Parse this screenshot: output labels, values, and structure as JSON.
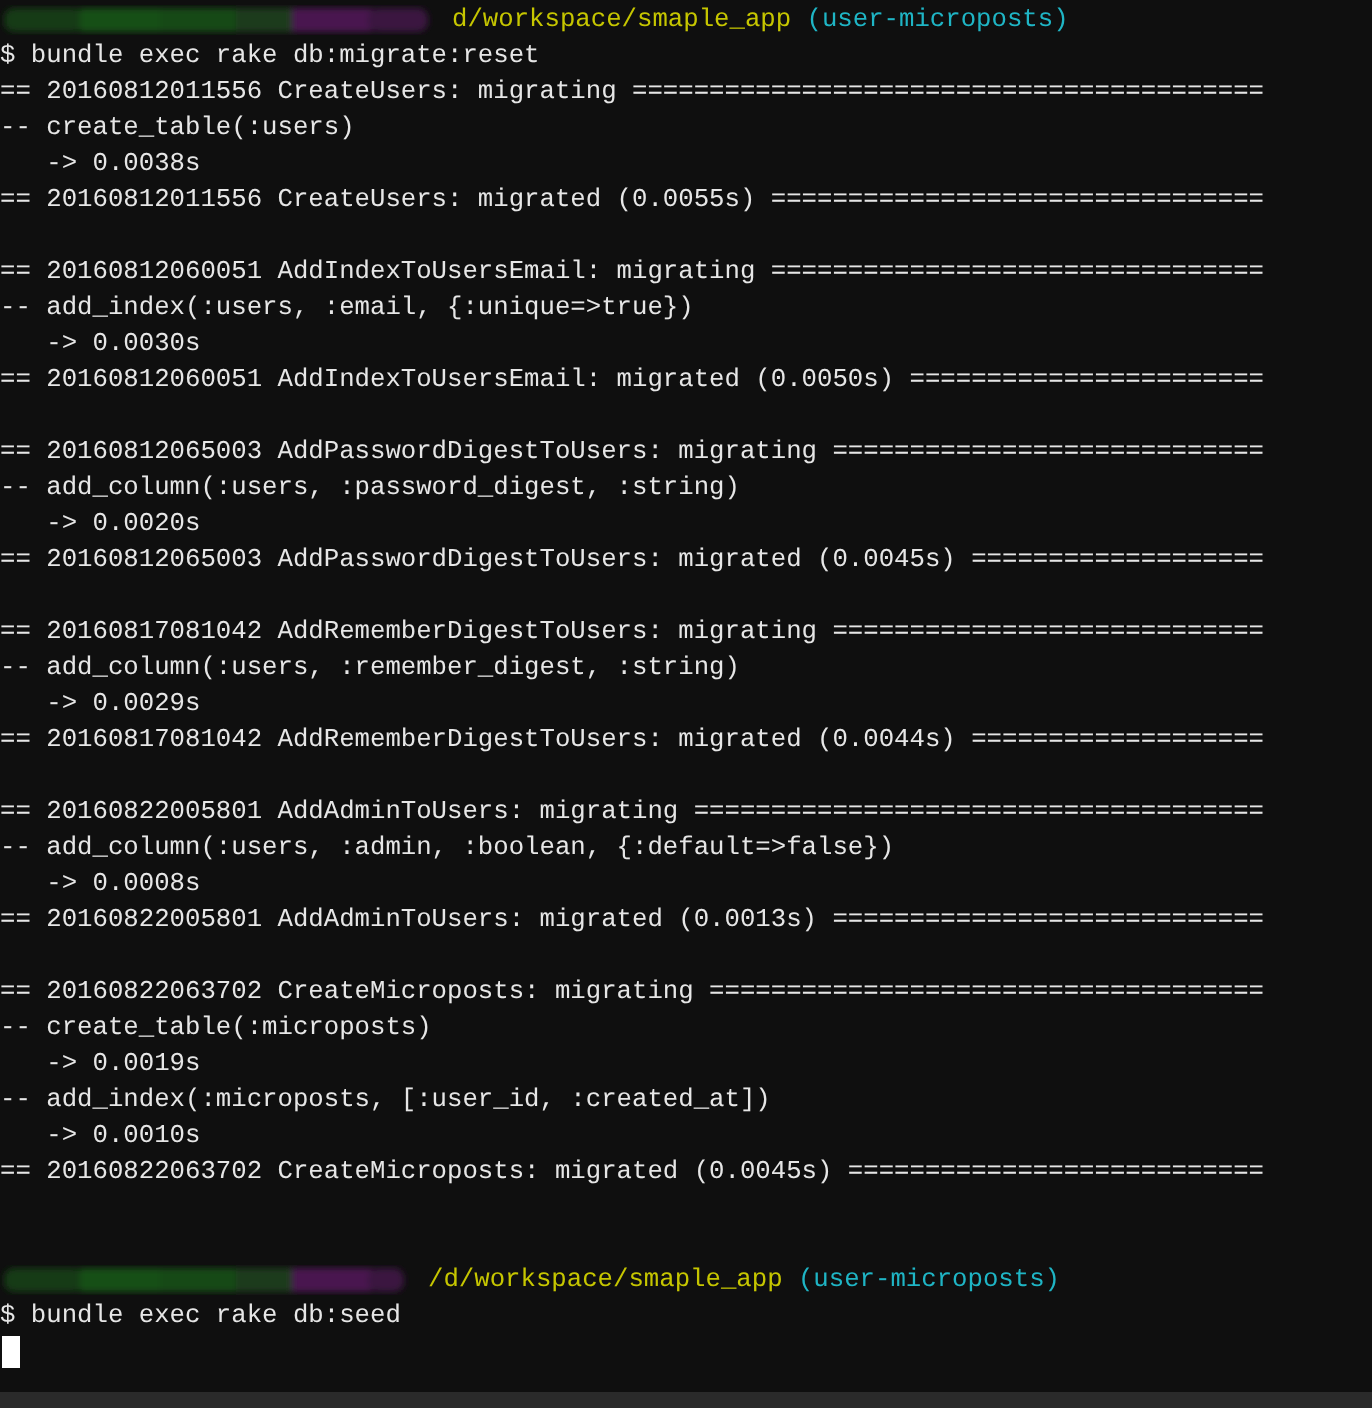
{
  "terminal": {
    "lines": [
      {
        "kind": "prompt",
        "path": "d/workspace/smaple_app",
        "branch": "(user-microposts)"
      },
      {
        "kind": "text",
        "text": "$ bundle exec rake db:migrate:reset"
      },
      {
        "kind": "text",
        "text": "== 20160812011556 CreateUsers: migrating ========================================="
      },
      {
        "kind": "text",
        "text": "-- create_table(:users)"
      },
      {
        "kind": "text",
        "text": "   -> 0.0038s"
      },
      {
        "kind": "text",
        "text": "== 20160812011556 CreateUsers: migrated (0.0055s) ================================"
      },
      {
        "kind": "blank"
      },
      {
        "kind": "text",
        "text": "== 20160812060051 AddIndexToUsersEmail: migrating ================================"
      },
      {
        "kind": "text",
        "text": "-- add_index(:users, :email, {:unique=>true})"
      },
      {
        "kind": "text",
        "text": "   -> 0.0030s"
      },
      {
        "kind": "text",
        "text": "== 20160812060051 AddIndexToUsersEmail: migrated (0.0050s) ======================="
      },
      {
        "kind": "blank"
      },
      {
        "kind": "text",
        "text": "== 20160812065003 AddPasswordDigestToUsers: migrating ============================"
      },
      {
        "kind": "text",
        "text": "-- add_column(:users, :password_digest, :string)"
      },
      {
        "kind": "text",
        "text": "   -> 0.0020s"
      },
      {
        "kind": "text",
        "text": "== 20160812065003 AddPasswordDigestToUsers: migrated (0.0045s) ==================="
      },
      {
        "kind": "blank"
      },
      {
        "kind": "text",
        "text": "== 20160817081042 AddRememberDigestToUsers: migrating ============================"
      },
      {
        "kind": "text",
        "text": "-- add_column(:users, :remember_digest, :string)"
      },
      {
        "kind": "text",
        "text": "   -> 0.0029s"
      },
      {
        "kind": "text",
        "text": "== 20160817081042 AddRememberDigestToUsers: migrated (0.0044s) ==================="
      },
      {
        "kind": "blank"
      },
      {
        "kind": "text",
        "text": "== 20160822005801 AddAdminToUsers: migrating ====================================="
      },
      {
        "kind": "text",
        "text": "-- add_column(:users, :admin, :boolean, {:default=>false})"
      },
      {
        "kind": "text",
        "text": "   -> 0.0008s"
      },
      {
        "kind": "text",
        "text": "== 20160822005801 AddAdminToUsers: migrated (0.0013s) ============================"
      },
      {
        "kind": "blank"
      },
      {
        "kind": "text",
        "text": "== 20160822063702 CreateMicroposts: migrating ===================================="
      },
      {
        "kind": "text",
        "text": "-- create_table(:microposts)"
      },
      {
        "kind": "text",
        "text": "   -> 0.0019s"
      },
      {
        "kind": "text",
        "text": "-- add_index(:microposts, [:user_id, :created_at])"
      },
      {
        "kind": "text",
        "text": "   -> 0.0010s"
      },
      {
        "kind": "text",
        "text": "== 20160822063702 CreateMicroposts: migrated (0.0045s) ==========================="
      },
      {
        "kind": "blank"
      },
      {
        "kind": "blank"
      },
      {
        "kind": "prompt",
        "path": "/d/workspace/smaple_app",
        "branch": "(user-microposts)"
      },
      {
        "kind": "text",
        "text": "$ bundle exec rake db:seed"
      },
      {
        "kind": "cursor"
      }
    ]
  }
}
